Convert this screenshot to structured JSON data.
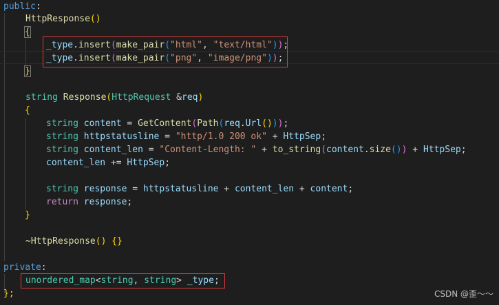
{
  "code": {
    "l01_public": "public",
    "l01_colon": ":",
    "l02_ctor": "HttpResponse",
    "l02_paren": "()",
    "l03_brace": "{",
    "l04_member": "_type",
    "l04_dot": ".",
    "l04_insert": "insert",
    "l04_open": "(",
    "l04_makepair": "make_pair",
    "l04_open2": "(",
    "l04_str1": "\"html\"",
    "l04_comma": ", ",
    "l04_str2": "\"text/html\"",
    "l04_close2": ")",
    "l04_close": ")",
    "l04_semi": ";",
    "l05_member": "_type",
    "l05_dot": ".",
    "l05_insert": "insert",
    "l05_open": "(",
    "l05_makepair": "make_pair",
    "l05_open2": "(",
    "l05_str1": "\"png\"",
    "l05_comma": ", ",
    "l05_str2": "\"image/png\"",
    "l05_close2": ")",
    "l05_close": ")",
    "l05_semi": ";",
    "l06_brace": "}",
    "l08_type": "string",
    "l08_fn": "Response",
    "l08_open": "(",
    "l08_ptype": "HttpRequest",
    "l08_amp": " &",
    "l08_param": "req",
    "l08_close": ")",
    "l09_brace": "{",
    "l10_type": "string",
    "l10_var": "content",
    "l10_eq": " = ",
    "l10_fn": "GetContent",
    "l10_o1": "(",
    "l10_fn2": "Path",
    "l10_o2": "(",
    "l10_var2": "req",
    "l10_dot": ".",
    "l10_var3": "Url",
    "l10_o3": "()",
    "l10_c2": ")",
    "l10_c1": ")",
    "l10_semi": ";",
    "l11_type": "string",
    "l11_var": "httpstatusline",
    "l11_eq": " = ",
    "l11_str": "\"http/1.0 200 ok\"",
    "l11_plus": " + ",
    "l11_var2": "HttpSep",
    "l11_semi": ";",
    "l12_type": "string",
    "l12_var": "content_len",
    "l12_eq": " = ",
    "l12_str": "\"Content-Length: \"",
    "l12_plus": " + ",
    "l12_fn": "to_string",
    "l12_o1": "(",
    "l12_var2": "content",
    "l12_dot": ".",
    "l12_fn2": "size",
    "l12_o2": "()",
    "l12_c1": ")",
    "l12_plus2": " + ",
    "l12_var3": "HttpSep",
    "l12_semi": ";",
    "l13_var": "content_len",
    "l13_op": " += ",
    "l13_var2": "HttpSep",
    "l13_semi": ";",
    "l15_type": "string",
    "l15_var": "response",
    "l15_eq": " = ",
    "l15_v1": "httpstatusline",
    "l15_p1": " + ",
    "l15_v2": "content_len",
    "l15_p2": " + ",
    "l15_v3": "content",
    "l15_semi": ";",
    "l16_kw": "return",
    "l16_var": " response",
    "l16_semi": ";",
    "l17_brace": "}",
    "l19_dtor": "~HttpResponse",
    "l19_paren": "() ",
    "l19_body": "{}",
    "l21_private": "private",
    "l21_colon": ":",
    "l22_type": "unordered_map",
    "l22_lt": "<",
    "l22_t1": "string",
    "l22_comma": ", ",
    "l22_t2": "string",
    "l22_gt": "> ",
    "l22_var": "_type",
    "l22_semi": ";",
    "l23_end": "};"
  },
  "watermark": "CSDN @歪～～",
  "colors": {
    "background": "#1e1e1e",
    "keyword": "#569cd6",
    "type": "#4ec9b0",
    "function": "#dcdcaa",
    "variable": "#9cdcfe",
    "string": "#ce9178",
    "highlight_border": "#e03b3b"
  }
}
